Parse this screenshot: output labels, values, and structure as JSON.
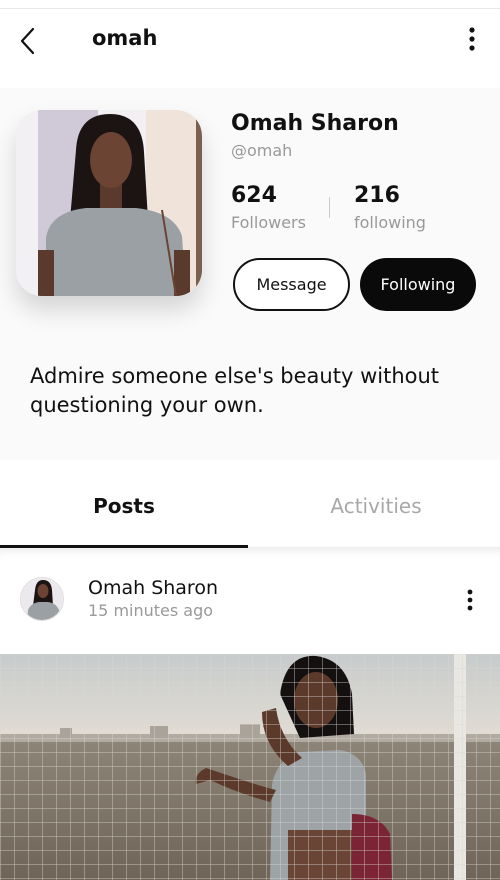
{
  "header": {
    "title": "omah",
    "back_icon": "chevron-left-icon",
    "menu_icon": "more-vertical-icon"
  },
  "profile": {
    "name": "Omah Sharon",
    "handle": "@omah",
    "followers_count": "624",
    "followers_label": "Followers",
    "following_count": "216",
    "following_label": "following",
    "message_label": "Message",
    "following_button_label": "Following",
    "bio": "Admire someone else's beauty without questioning your own."
  },
  "tabs": [
    {
      "label": "Posts",
      "active": true
    },
    {
      "label": "Activities",
      "active": false
    }
  ],
  "post": {
    "author": "Omah Sharon",
    "time": "15 minutes ago",
    "menu_icon": "more-vertical-icon"
  },
  "colors": {
    "accent": "#0a0a0a",
    "muted_text": "#999999",
    "background": "#ffffff"
  }
}
